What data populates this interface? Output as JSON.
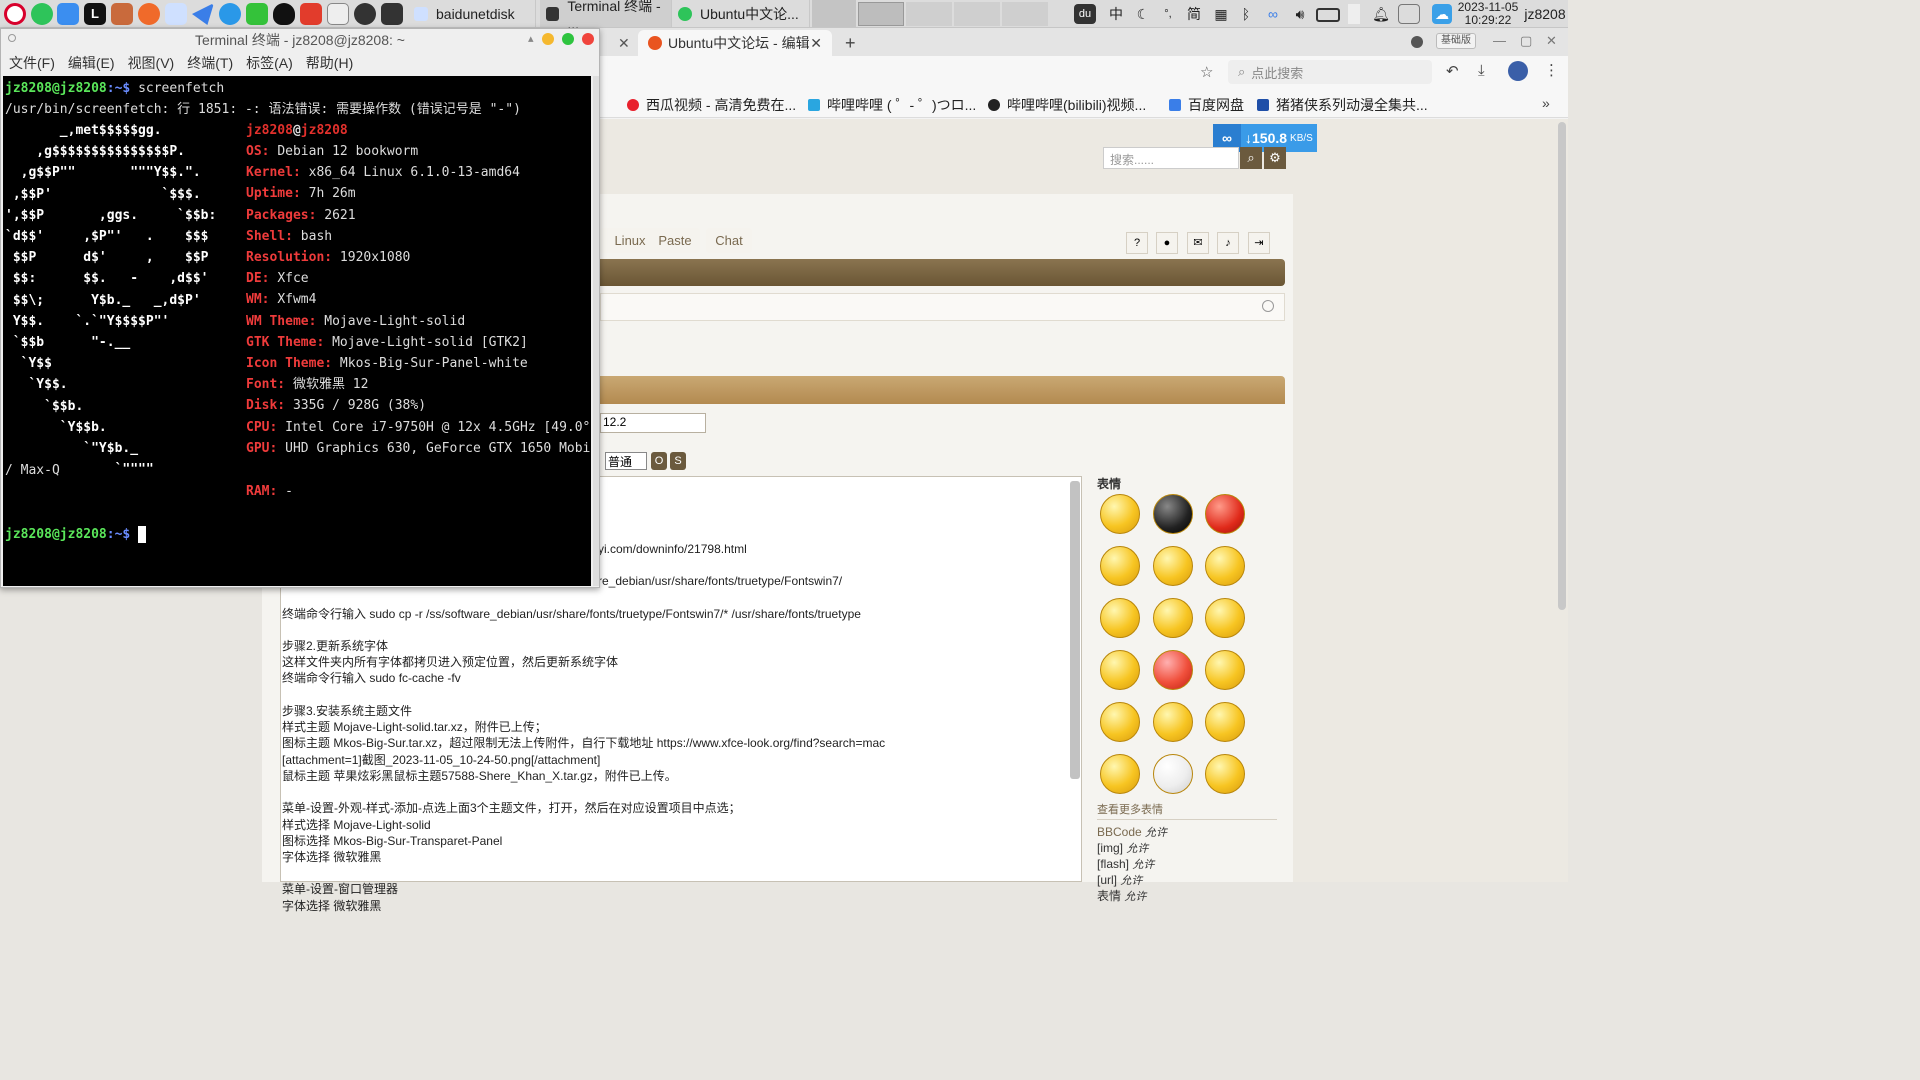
{
  "panel": {
    "tasks": [
      "baidunetdisk",
      "Terminal 终端 - ...",
      "Ubuntu中文论..."
    ],
    "tray": {
      "ime": "中",
      "punct": "°,",
      "simp": "简",
      "date": "2023-11-05",
      "time": "10:29:22",
      "user": "jz8208"
    }
  },
  "terminal": {
    "title": "Terminal 终端 - jz8208@jz8208: ~",
    "menu": [
      "文件(F)",
      "编辑(E)",
      "视图(V)",
      "终端(T)",
      "标签(A)",
      "帮助(H)"
    ],
    "user": "jz8208",
    "host": "jz8208",
    "prompt_sep": "@",
    "prompt_tail": ":~$",
    "command": "screenfetch",
    "error": "/usr/bin/screenfetch: 行 1851: -: 语法错误: 需要操作数 (错误记号是 \"-\")",
    "logo": [
      "       _,met$$$$$gg.",
      "    ,g$$$$$$$$$$$$$$$P.",
      "  ,g$$P\"\"       \"\"\"Y$$.\".",
      " ,$$P'              `$$$.",
      "',$$P       ,ggs.     `$$b:",
      "`d$$'     ,$P\"'   .    $$$",
      " $$P      d$'     ,    $$P",
      " $$:      $$.   -    ,d$$'",
      " $$\\;      Y$b._   _,d$P'",
      " Y$$.    `.`\"Y$$$$P\"'",
      " `$$b      \"-.__",
      "  `Y$$",
      "   `Y$$.",
      "     `$$b.",
      "       `Y$$b.",
      "          `\"Y$b._",
      "              `\"\"\"\""
    ],
    "info": [
      {
        "k": "OS:",
        "v": "Debian 12 bookworm"
      },
      {
        "k": "Kernel:",
        "v": "x86_64 Linux 6.1.0-13-amd64"
      },
      {
        "k": "Uptime:",
        "v": "7h 26m"
      },
      {
        "k": "Packages:",
        "v": "2621"
      },
      {
        "k": "Shell:",
        "v": "bash"
      },
      {
        "k": "Resolution:",
        "v": "1920x1080"
      },
      {
        "k": "DE:",
        "v": "Xfce"
      },
      {
        "k": "WM:",
        "v": "Xfwm4"
      },
      {
        "k": "WM Theme:",
        "v": "Mojave-Light-solid"
      },
      {
        "k": "GTK Theme:",
        "v": "Mojave-Light-solid [GTK2]"
      },
      {
        "k": "Icon Theme:",
        "v": "Mkos-Big-Sur-Panel-white"
      },
      {
        "k": "Font:",
        "v": "微软雅黑 12"
      },
      {
        "k": "Disk:",
        "v": "335G / 928G (38%)"
      },
      {
        "k": "CPU:",
        "v": "Intel Core i7-9750H @ 12x 4.5GHz [49.0°C]"
      },
      {
        "k": "GPU:",
        "v": "UHD Graphics 630, GeForce GTX 1650 Mobile"
      }
    ],
    "gpu_wrap": "/ Max-Q",
    "ram_label": "RAM:",
    "ram_value": "-"
  },
  "browser": {
    "tab_active": "Ubuntu中文论坛 - 编辑",
    "tab_new": "+",
    "search_placeholder": "点此搜索",
    "version_badge": "基础版",
    "bookmarks": [
      "西瓜视频 - 高清免费在...",
      "哔哩哔哩 ( ゜- ゜)つロ...",
      "哔哩哔哩(bilibili)视频...",
      "百度网盘",
      "猪猪侠系列动漫全集共..."
    ],
    "download_speed": "150.8",
    "download_unit": "KB/S"
  },
  "forum": {
    "search_placeholder": "搜索......",
    "nav_tabs": [
      "Linux",
      "Paste",
      "Chat"
    ],
    "subject_value": "12.2",
    "font_size_select": "普通",
    "btn_o": "O",
    "btn_s": "S",
    "editor_lines": [
      "yi.com/downinfo/21798.html",
      "re_debian/usr/share/fonts/truetype/Fontswin7/",
      "终端命令行输入 sudo cp -r /ss/software_debian/usr/share/fonts/truetype/Fontswin7/* /usr/share/fonts/truetype",
      "",
      "步骤2.更新系统字体",
      "这样文件夹内所有字体都拷贝进入预定位置，然后更新系统字体",
      "终端命令行输入 sudo fc-cache -fv",
      "",
      "步骤3.安装系统主题文件",
      "样式主题 Mojave-Light-solid.tar.xz，附件已上传；",
      "图标主题 Mkos-Big-Sur.tar.xz，超过限制无法上传附件，自行下载地址 https://www.xfce-look.org/find?search=mac",
      "[attachment=1]截图_2023-11-05_10-24-50.png[/attachment]",
      "鼠标主题 苹果炫彩黑鼠标主题57588-Shere_Khan_X.tar.gz，附件已上传。",
      "",
      "菜单-设置-外观-样式-添加-点选上面3个主题文件，打开，然后在对应设置项目中点选；",
      "样式选择 Mojave-Light-solid",
      "图标选择 Mkos-Big-Sur-Transparet-Panel",
      "字体选择 微软雅黑",
      "",
      "菜单-设置-窗口管理器",
      "字体选择 微软雅黑"
    ],
    "smilies_title": "表情",
    "more_smilies": "查看更多表情",
    "bbcode": [
      {
        "k": "BBCode",
        "v": "允许"
      },
      {
        "k": "[img]",
        "v": "允许"
      },
      {
        "k": "[flash]",
        "v": "允许"
      },
      {
        "k": "[url]",
        "v": "允许"
      },
      {
        "k": "表情",
        "v": "允许"
      }
    ]
  }
}
